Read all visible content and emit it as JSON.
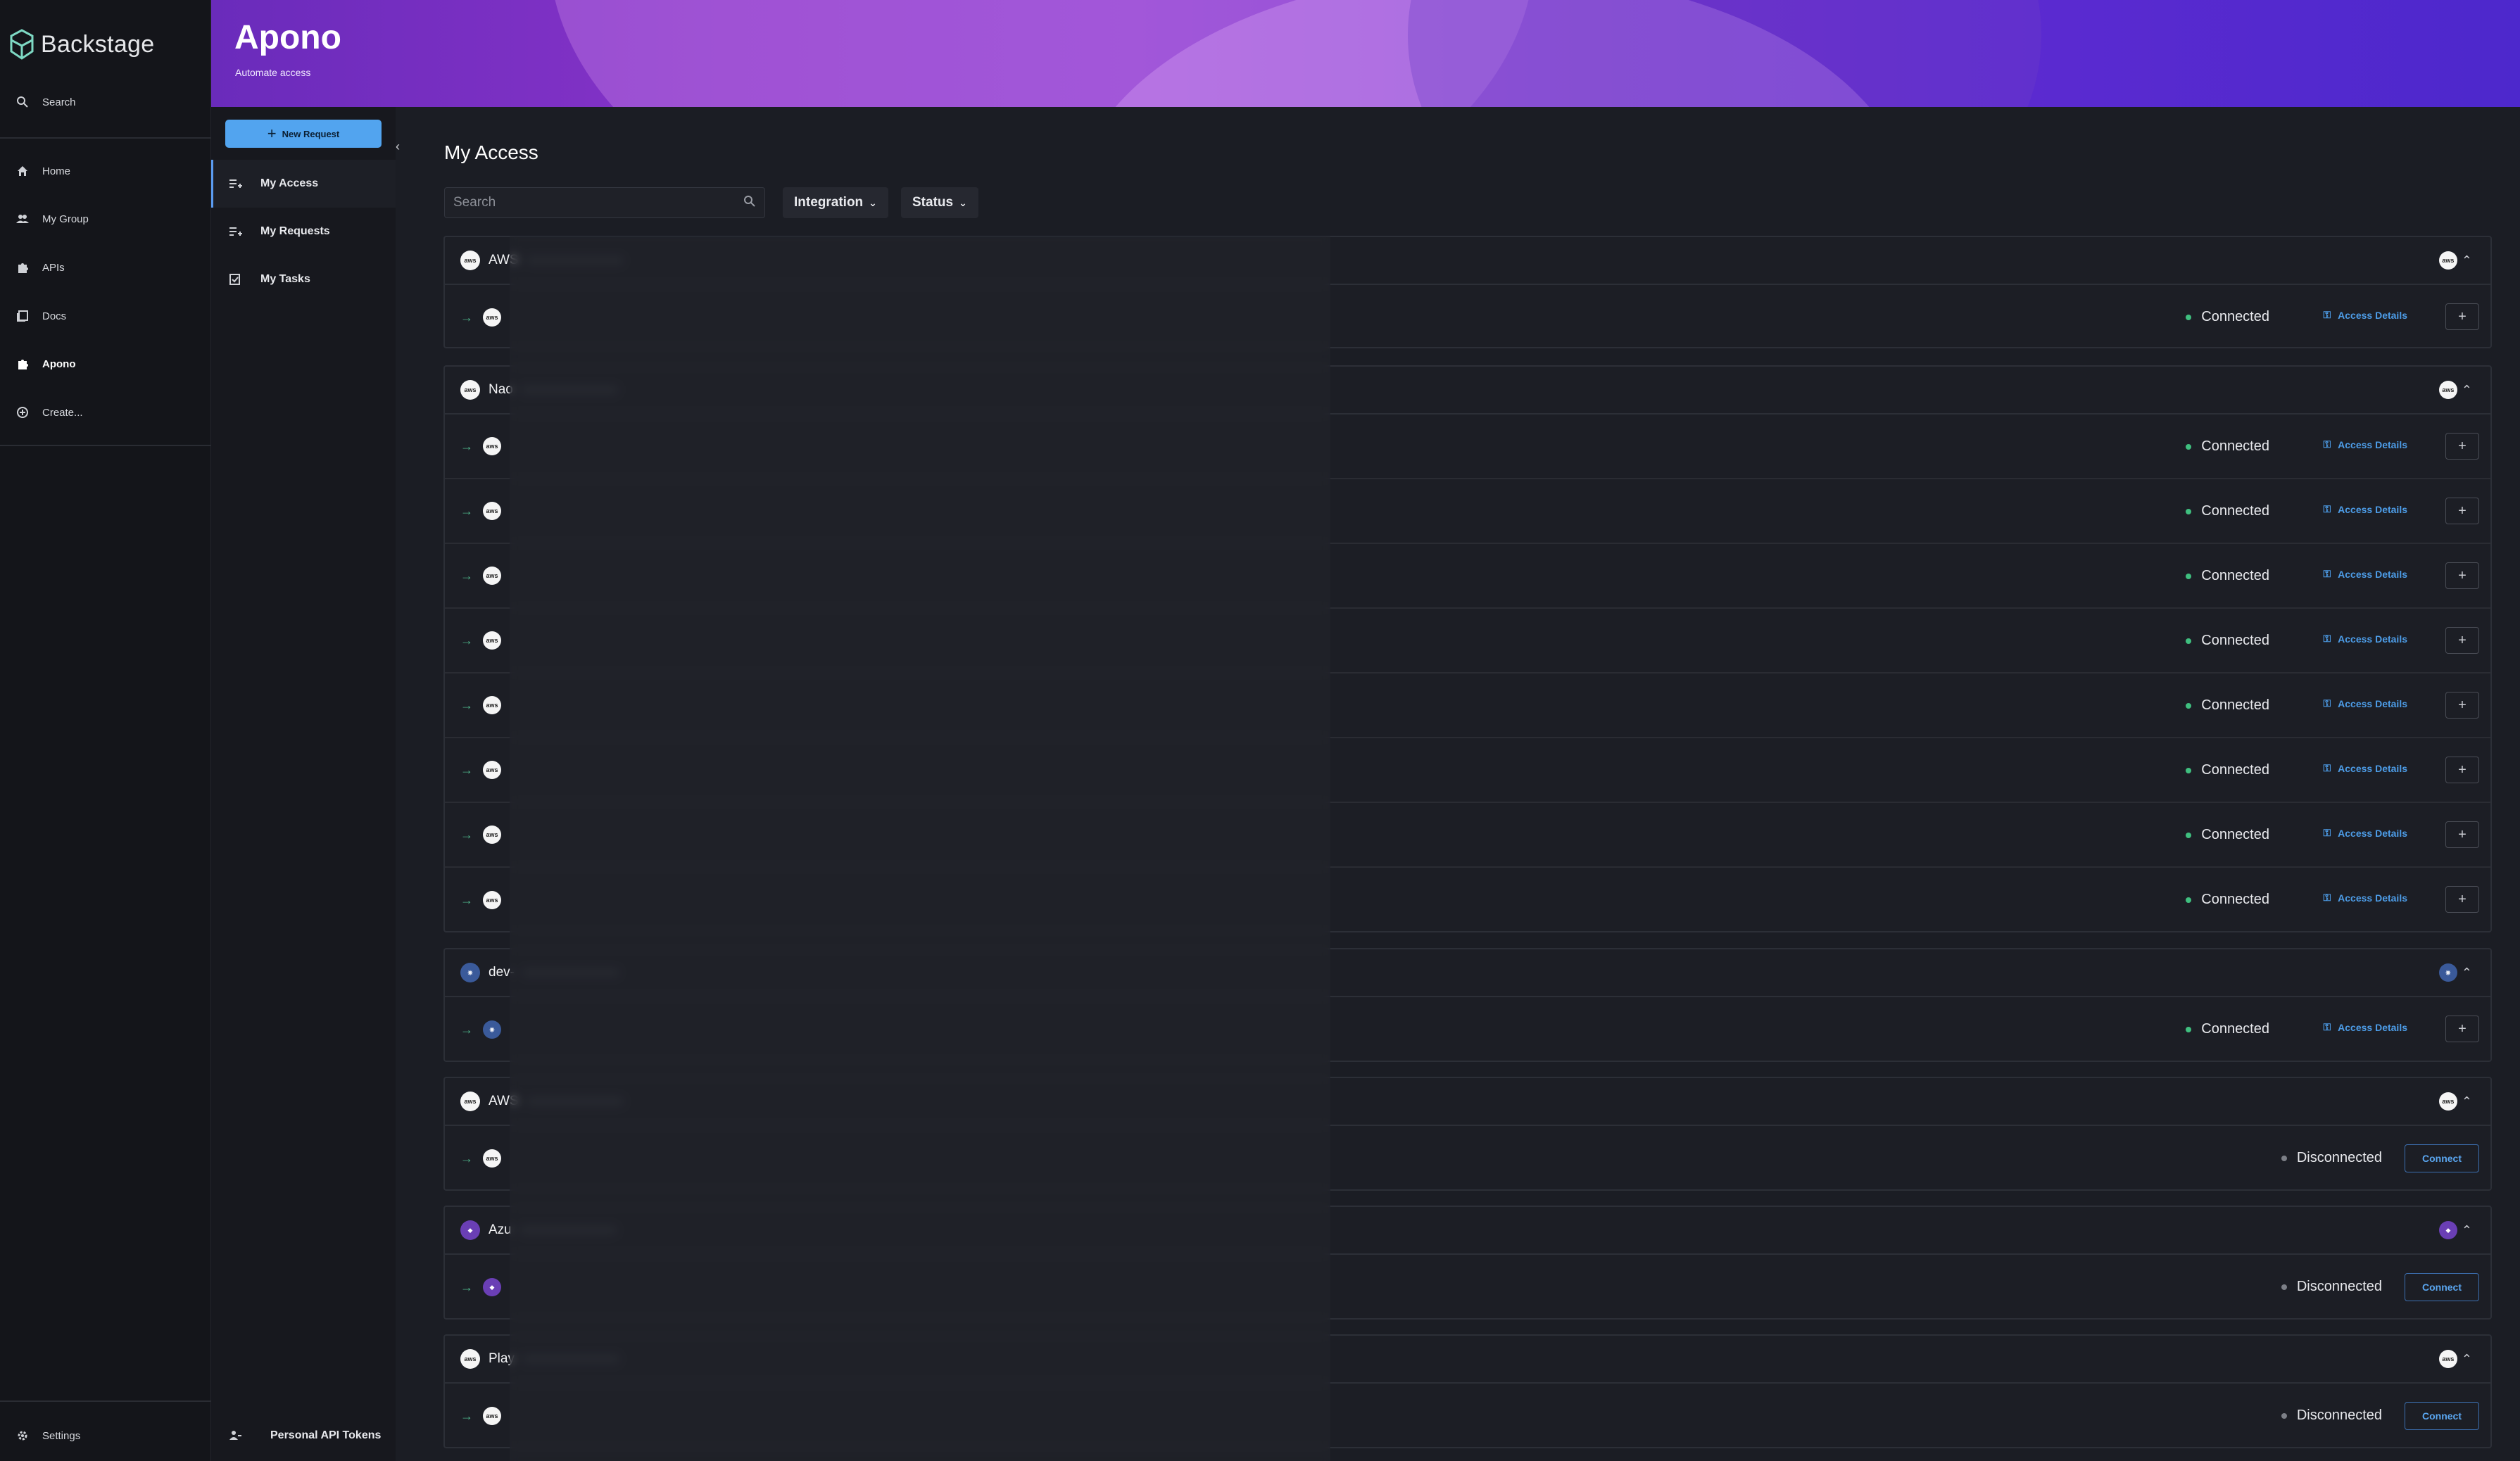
{
  "brand": {
    "name": "Backstage"
  },
  "nav": {
    "search": "Search",
    "items": [
      {
        "label": "Home",
        "icon": "home-icon"
      },
      {
        "label": "My Group",
        "icon": "group-icon"
      },
      {
        "label": "APIs",
        "icon": "puzzle-icon"
      },
      {
        "label": "Docs",
        "icon": "docs-icon"
      },
      {
        "label": "Apono",
        "icon": "puzzle-icon"
      },
      {
        "label": "Create...",
        "icon": "create-icon"
      }
    ],
    "settings": "Settings"
  },
  "header": {
    "title": "Apono",
    "subtitle": "Automate access"
  },
  "subnav": {
    "new_request": "New Request",
    "items": [
      {
        "label": "My Access"
      },
      {
        "label": "My Requests"
      },
      {
        "label": "My Tasks"
      }
    ],
    "api_tokens": "Personal API Tokens"
  },
  "main": {
    "title": "My Access",
    "search_placeholder": "Search",
    "filters": {
      "integration": "Integration",
      "status": "Status"
    },
    "access_details": "Access Details",
    "connect": "Connect",
    "status_connected": "Connected",
    "status_disconnected": "Disconnected",
    "groups": [
      {
        "name": "AWS",
        "logo": "aws-icon"
      },
      {
        "name": "Nao",
        "logo": "aws-icon"
      },
      {
        "name": "dev-",
        "logo": "kubernetes-icon"
      },
      {
        "name": "AWS",
        "logo": "aws-icon"
      },
      {
        "name": "Azu",
        "logo": "azure-icon"
      },
      {
        "name": "Play",
        "logo": "aws-icon"
      }
    ]
  },
  "colors": {
    "accent": "#52a4ef",
    "connected": "#3fbf7f",
    "header_purple": "#7b30c8"
  }
}
